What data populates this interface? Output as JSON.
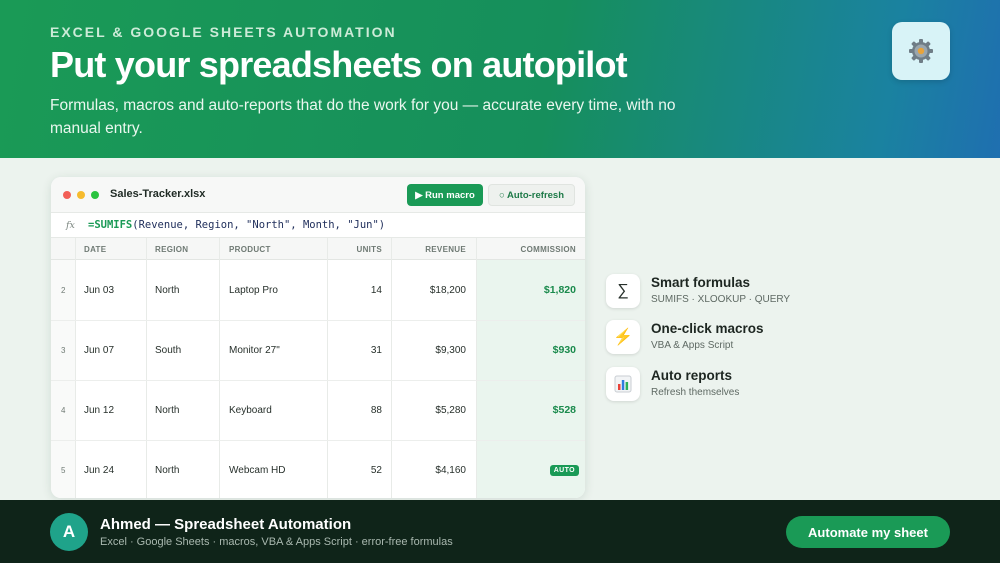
{
  "hero": {
    "eyebrow": "EXCEL & GOOGLE SHEETS AUTOMATION",
    "headline": "Put your spreadsheets on autopilot",
    "subhead": "Formulas, macros and auto-reports that do the work for you — accurate every time, with no manual entry.",
    "badge_icon": "gear-icon"
  },
  "sheet": {
    "filename": "Sales-Tracker.xlsx",
    "run_label": "▶ Run macro",
    "refresh_label": "○ Auto-refresh",
    "fx_label": "fx",
    "formula_fn": "=SUMIFS",
    "formula_args": "(Revenue, Region, \"North\", Month, \"Jun\")",
    "columns": [
      "DATE",
      "REGION",
      "PRODUCT",
      "UNITS",
      "REVENUE",
      "COMMISSION"
    ],
    "rows": [
      {
        "num": "2",
        "date": "Jun 03",
        "region": "North",
        "product": "Laptop Pro",
        "units": "14",
        "revenue": "$18,200",
        "commission": "$1,820"
      },
      {
        "num": "3",
        "date": "Jun 07",
        "region": "South",
        "product": "Monitor 27\"",
        "units": "31",
        "revenue": "$9,300",
        "commission": "$930"
      },
      {
        "num": "4",
        "date": "Jun 12",
        "region": "North",
        "product": "Keyboard",
        "units": "88",
        "revenue": "$5,280",
        "commission": "$528"
      },
      {
        "num": "5",
        "date": "Jun 24",
        "region": "North",
        "product": "Webcam HD",
        "units": "52",
        "revenue": "$4,160",
        "commission": "AUTO"
      }
    ],
    "accent_color": "#1a9a56"
  },
  "features": [
    {
      "icon": "sigma-icon",
      "glyph": "∑",
      "title": "Smart formulas",
      "subtitle": "SUMIFS · XLOOKUP · QUERY"
    },
    {
      "icon": "lightning-icon",
      "glyph": "⚡",
      "title": "One-click macros",
      "subtitle": "VBA & Apps Script"
    },
    {
      "icon": "bar-chart-icon",
      "glyph": "",
      "title": "Auto reports",
      "subtitle": "Refresh themselves"
    }
  ],
  "footer": {
    "avatar_letter": "A",
    "name": "Ahmed — Spreadsheet Automation",
    "tagline": "Excel · Google Sheets · macros, VBA & Apps Script · error-free formulas",
    "cta": "Automate my sheet"
  }
}
